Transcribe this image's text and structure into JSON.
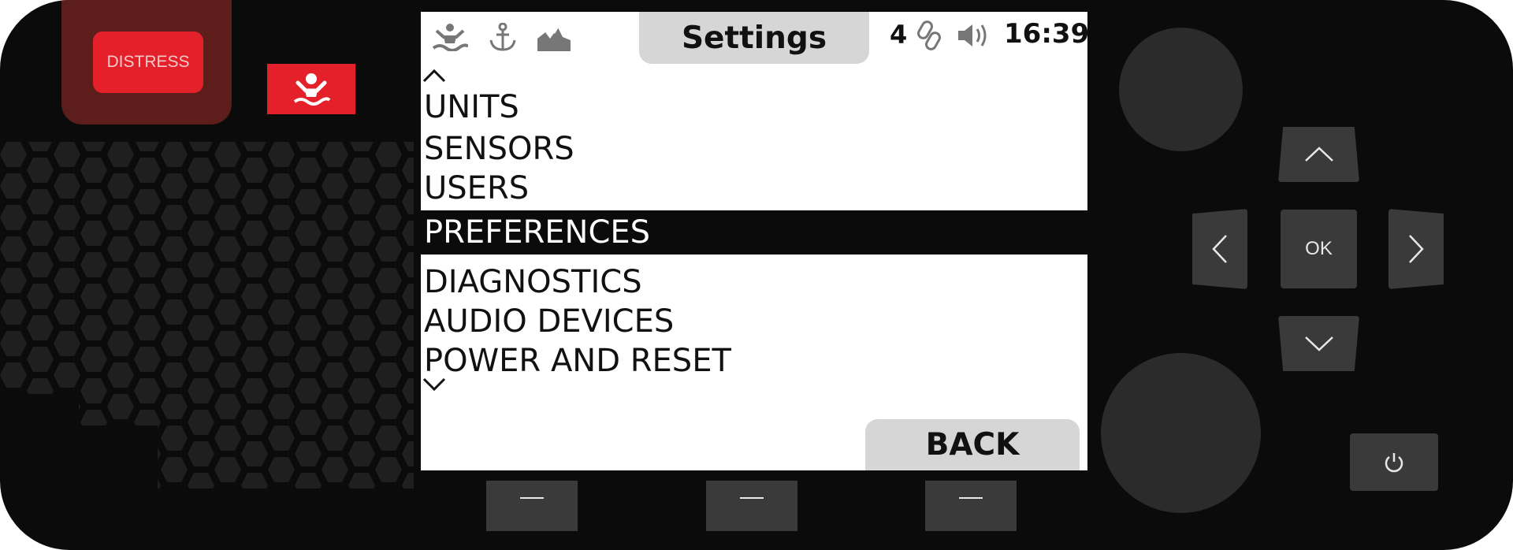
{
  "panel": {
    "distress_label": "DISTRESS",
    "mob_icon": "man-overboard-icon"
  },
  "status_bar": {
    "icons": [
      "man-overboard-icon",
      "anchor-icon",
      "broken-signal-icon",
      "link-icon",
      "speaker-icon"
    ],
    "title": "Settings",
    "channel_count": "4",
    "time": "16:39"
  },
  "menu": {
    "items": [
      "UNITS",
      "SENSORS",
      "USERS",
      "PREFERENCES",
      "DIAGNOSTICS",
      "AUDIO DEVICES",
      "POWER AND RESET"
    ],
    "selected": "PREFERENCES"
  },
  "softkeys": {
    "back_label": "BACK",
    "keys": [
      "—",
      "—",
      "—"
    ]
  },
  "dpad": {
    "ok_label": "OK"
  },
  "colors": {
    "housing": "#0b0b0b",
    "distress": "#e4202a",
    "selection": "#0b0b0b",
    "tab": "#d6d6d6"
  }
}
